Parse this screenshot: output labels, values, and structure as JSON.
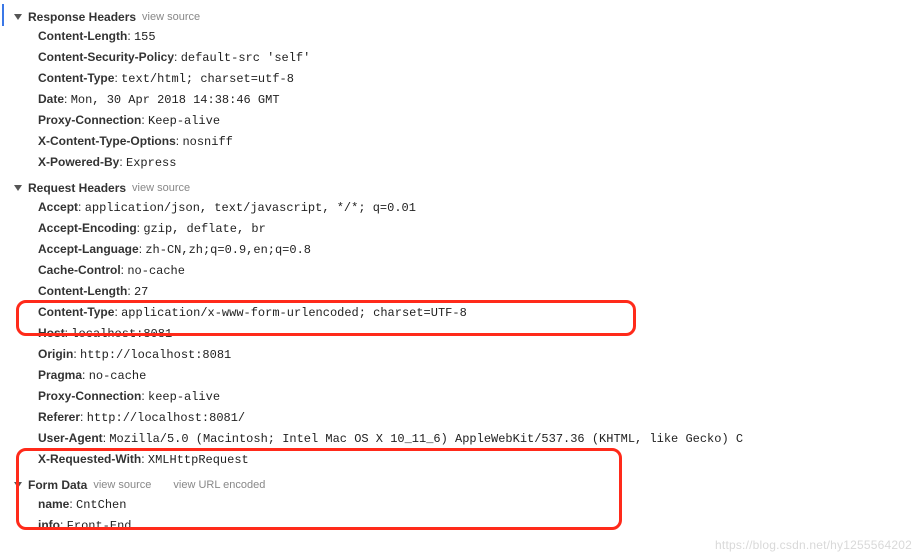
{
  "sections": {
    "response": {
      "title": "Response Headers",
      "links": [
        "view source"
      ],
      "items": [
        {
          "key": "Content-Length",
          "val": "155"
        },
        {
          "key": "Content-Security-Policy",
          "val": "default-src 'self'"
        },
        {
          "key": "Content-Type",
          "val": "text/html; charset=utf-8"
        },
        {
          "key": "Date",
          "val": "Mon, 30 Apr 2018 14:38:46 GMT"
        },
        {
          "key": "Proxy-Connection",
          "val": "Keep-alive"
        },
        {
          "key": "X-Content-Type-Options",
          "val": "nosniff"
        },
        {
          "key": "X-Powered-By",
          "val": "Express"
        }
      ]
    },
    "request": {
      "title": "Request Headers",
      "links": [
        "view source"
      ],
      "items": [
        {
          "key": "Accept",
          "val": "application/json, text/javascript, */*; q=0.01"
        },
        {
          "key": "Accept-Encoding",
          "val": "gzip, deflate, br"
        },
        {
          "key": "Accept-Language",
          "val": "zh-CN,zh;q=0.9,en;q=0.8"
        },
        {
          "key": "Cache-Control",
          "val": "no-cache"
        },
        {
          "key": "Content-Length",
          "val": "27"
        },
        {
          "key": "Content-Type",
          "val": "application/x-www-form-urlencoded; charset=UTF-8"
        },
        {
          "key": "Host",
          "val": "localhost:8081"
        },
        {
          "key": "Origin",
          "val": "http://localhost:8081"
        },
        {
          "key": "Pragma",
          "val": "no-cache"
        },
        {
          "key": "Proxy-Connection",
          "val": "keep-alive"
        },
        {
          "key": "Referer",
          "val": "http://localhost:8081/"
        },
        {
          "key": "User-Agent",
          "val": "Mozilla/5.0 (Macintosh; Intel Mac OS X 10_11_6) AppleWebKit/537.36 (KHTML, like Gecko) C"
        },
        {
          "key": "X-Requested-With",
          "val": "XMLHttpRequest"
        }
      ]
    },
    "formdata": {
      "title": "Form Data",
      "links": [
        "view source",
        "view URL encoded"
      ],
      "items": [
        {
          "key": "name",
          "val": "CntChen"
        },
        {
          "key": "info",
          "val": "Front-End"
        }
      ]
    }
  },
  "watermark": "https://blog.csdn.net/hy1255564202"
}
